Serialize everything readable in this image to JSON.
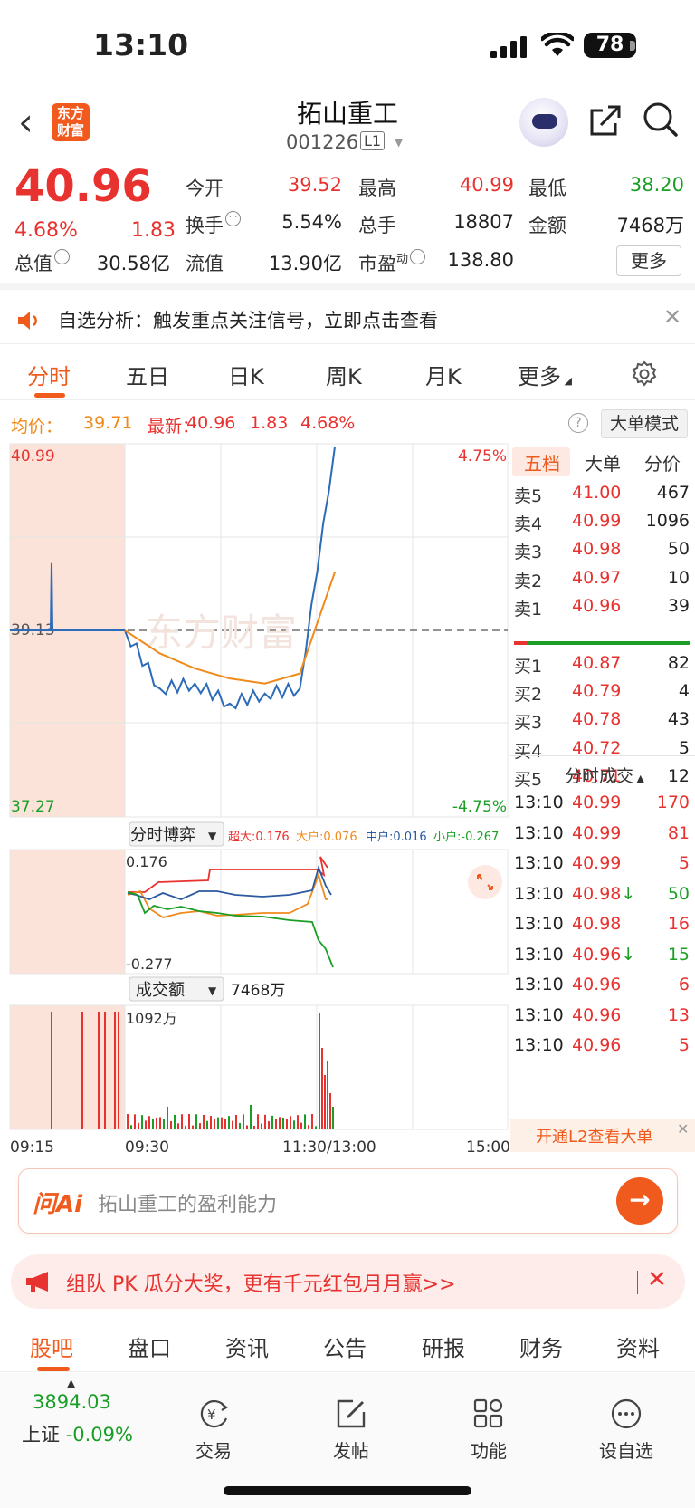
{
  "status": {
    "time": "13:10",
    "battery": "78"
  },
  "header": {
    "logo_text_1": "东方",
    "logo_text_2": "财富",
    "stock_name": "拓山重工",
    "stock_code": "001226",
    "level": "L1"
  },
  "quote": {
    "price": "40.96",
    "pct": "4.68%",
    "change": "1.83",
    "open_label": "今开",
    "open": "39.52",
    "high_label": "最高",
    "high": "40.99",
    "low_label": "最低",
    "low": "38.20",
    "turnover_label": "换手",
    "turnover": "5.54%",
    "vol_label": "总手",
    "vol": "18807",
    "amount_label": "金额",
    "amount": "7468万",
    "mcap_label": "总值",
    "mcap": "30.58亿",
    "float_label": "流值",
    "float": "13.90亿",
    "pe_label": "市盈",
    "pe_sup": "动",
    "pe": "138.80",
    "more": "更多"
  },
  "notice": {
    "text": "自选分析：触发重点关注信号，立即点击查看"
  },
  "tabs": [
    "分时",
    "五日",
    "日K",
    "周K",
    "月K",
    "更多"
  ],
  "legend": {
    "avg_label": "均价：",
    "avg": "39.71",
    "last_label": "最新：",
    "last": "40.96",
    "chg": "1.83",
    "pct": "4.68%",
    "big_mode": "大单模式"
  },
  "chart": {
    "y_top": "40.99",
    "y_mid": "39.13",
    "y_bot": "37.27",
    "pct_top": "4.75%",
    "pct_bot": "-4.75%",
    "watermark": "东方财富",
    "game_label": "分时博弈",
    "game_legend": {
      "super": "超大:0.176",
      "big": "大户:0.076",
      "mid": "中户:0.016",
      "small": "小户:-0.267"
    },
    "game_top": "0.176",
    "game_bot": "-0.277",
    "amt_label": "成交额",
    "amt_val": "7468万",
    "amt_max": "1092万",
    "x_labels": [
      "09:15",
      "09:30",
      "11:30/13:00",
      "15:00"
    ]
  },
  "chart_data": {
    "type": "line",
    "title": "",
    "xlabel": "",
    "ylabel": "",
    "ylim": [
      37.27,
      40.99
    ],
    "x": [
      "09:30",
      "10:00",
      "10:30",
      "11:00",
      "11:30",
      "13:00",
      "13:10"
    ],
    "series": [
      {
        "name": "",
        "values": [
          39.13,
          38.55,
          38.6,
          38.4,
          38.5,
          38.55,
          40.96
        ]
      },
      {
        "name": "",
        "values": [
          39.13,
          38.9,
          38.75,
          38.65,
          38.6,
          38.7,
          39.71
        ]
      }
    ]
  },
  "book": {
    "tabs": [
      "五档",
      "大单",
      "分价"
    ],
    "sell": [
      {
        "label": "卖5",
        "price": "41.00",
        "vol": "467"
      },
      {
        "label": "卖4",
        "price": "40.99",
        "vol": "1096"
      },
      {
        "label": "卖3",
        "price": "40.98",
        "vol": "50"
      },
      {
        "label": "卖2",
        "price": "40.97",
        "vol": "10"
      },
      {
        "label": "卖1",
        "price": "40.96",
        "vol": "39"
      }
    ],
    "buy": [
      {
        "label": "买1",
        "price": "40.87",
        "vol": "82"
      },
      {
        "label": "买2",
        "price": "40.79",
        "vol": "4"
      },
      {
        "label": "买3",
        "price": "40.78",
        "vol": "43"
      },
      {
        "label": "买4",
        "price": "40.72",
        "vol": "5"
      },
      {
        "label": "买5",
        "price": "40.71",
        "vol": "12"
      }
    ],
    "trades_label": "分时成交",
    "trades": [
      {
        "t": "13:10",
        "p": "40.99",
        "v": "170",
        "dir": "red"
      },
      {
        "t": "13:10",
        "p": "40.99",
        "v": "81",
        "dir": "red"
      },
      {
        "t": "13:10",
        "p": "40.99",
        "v": "5",
        "dir": "red"
      },
      {
        "t": "13:10",
        "p": "40.98↓",
        "v": "50",
        "dir": "green"
      },
      {
        "t": "13:10",
        "p": "40.98",
        "v": "16",
        "dir": "red"
      },
      {
        "t": "13:10",
        "p": "40.96↓",
        "v": "15",
        "dir": "green"
      },
      {
        "t": "13:10",
        "p": "40.96",
        "v": "6",
        "dir": "red"
      },
      {
        "t": "13:10",
        "p": "40.96",
        "v": "13",
        "dir": "red"
      },
      {
        "t": "13:10",
        "p": "40.96",
        "v": "5",
        "dir": "red"
      }
    ],
    "l2_text": "开通L2查看大单"
  },
  "ai": {
    "logo": "问Ai",
    "placeholder": "拓山重工的盈利能力"
  },
  "promo": {
    "text": "组队 PK 瓜分大奖，更有千元红包月月赢>>"
  },
  "bottom_tabs": [
    "股吧",
    "盘口",
    "资讯",
    "公告",
    "研报",
    "财务",
    "资料"
  ],
  "bottom_nav": {
    "index_val": "3894.03",
    "index_label": "上证",
    "index_pct": "-0.09%",
    "trade": "交易",
    "post": "发帖",
    "func": "功能",
    "watch": "设自选"
  }
}
